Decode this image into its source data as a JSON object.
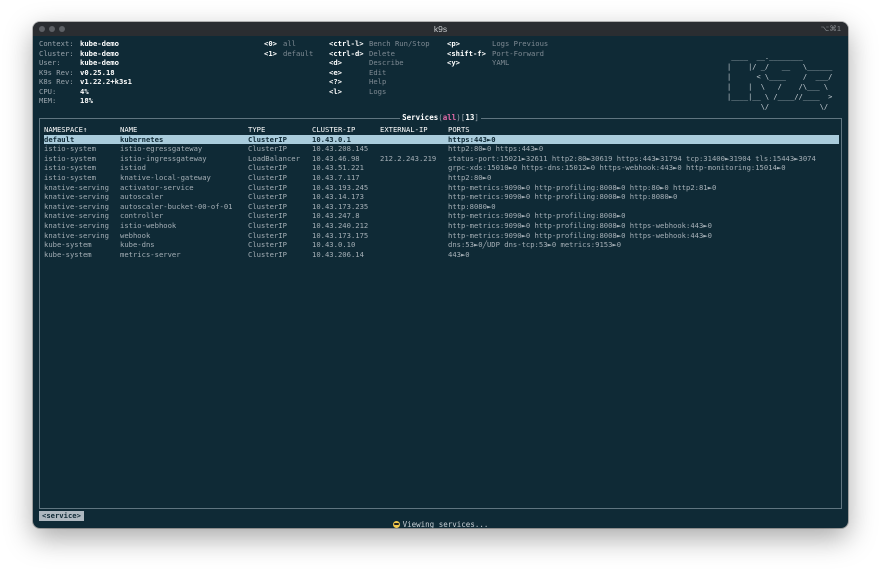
{
  "window": {
    "title": "k9s",
    "shortcut_hint": "⌥⌘1"
  },
  "info": [
    {
      "label": "Context:",
      "value": "kube-demo"
    },
    {
      "label": "Cluster:",
      "value": "kube-demo"
    },
    {
      "label": "User:",
      "value": "kube-demo"
    },
    {
      "label": "K9s Rev:",
      "value": "v0.25.18"
    },
    {
      "label": "K8s Rev:",
      "value": "v1.22.2+k3s1"
    },
    {
      "label": "CPU:",
      "value": "4%"
    },
    {
      "label": "MEM:",
      "value": "18%"
    }
  ],
  "namespace_shortcuts": [
    {
      "key": "<0>",
      "desc": "all"
    },
    {
      "key": "<1>",
      "desc": "default"
    }
  ],
  "hotkeys_col1": [
    {
      "key": "<ctrl-l>",
      "desc": "Bench Run/Stop"
    },
    {
      "key": "<ctrl-d>",
      "desc": "Delete"
    },
    {
      "key": "<d>",
      "desc": "Describe"
    },
    {
      "key": "<e>",
      "desc": "Edit"
    },
    {
      "key": "<?>",
      "desc": "Help"
    },
    {
      "key": "<l>",
      "desc": "Logs"
    }
  ],
  "hotkeys_col2": [
    {
      "key": "<p>",
      "desc": "Logs Previous"
    },
    {
      "key": "<shift-f>",
      "desc": "Port-Forward"
    },
    {
      "key": "<y>",
      "desc": "YAML"
    }
  ],
  "logo": [
    " ____  __.________        ",
    "|    |/ _/   __   \\______ ",
    "|      < \\____    /  ___/ ",
    "|    |  \\   /    /\\___ \\  ",
    "|____|__ \\ /____//____  > ",
    "        \\/            \\/  "
  ],
  "table": {
    "title_name": "Services",
    "title_scope": "all",
    "title_count": "13",
    "headers": [
      "NAMESPACE↑",
      "NAME",
      "TYPE",
      "CLUSTER-IP",
      "EXTERNAL-IP",
      "PORTS"
    ],
    "rows": [
      [
        "default",
        "kubernetes",
        "ClusterIP",
        "10.43.0.1",
        "",
        "https:443►0"
      ],
      [
        "istio-system",
        "istio-egressgateway",
        "ClusterIP",
        "10.43.208.145",
        "",
        "http2:80►0 https:443►0"
      ],
      [
        "istio-system",
        "istio-ingressgateway",
        "LoadBalancer",
        "10.43.46.98",
        "212.2.243.219",
        "status-port:15021►32611 http2:80►30619 https:443►31794 tcp:31400►31904 tls:15443►3074"
      ],
      [
        "istio-system",
        "istiod",
        "ClusterIP",
        "10.43.51.221",
        "",
        "grpc-xds:15010►0 https-dns:15012►0 https-webhook:443►0 http-monitoring:15014►0"
      ],
      [
        "istio-system",
        "knative-local-gateway",
        "ClusterIP",
        "10.43.7.117",
        "",
        "http2:80►0"
      ],
      [
        "knative-serving",
        "activator-service",
        "ClusterIP",
        "10.43.193.245",
        "",
        "http-metrics:9090►0 http-profiling:8008►0 http:80►0 http2:81►0"
      ],
      [
        "knative-serving",
        "autoscaler",
        "ClusterIP",
        "10.43.14.173",
        "",
        "http-metrics:9090►0 http-profiling:8008►0 http:8080►0"
      ],
      [
        "knative-serving",
        "autoscaler-bucket-00-of-01",
        "ClusterIP",
        "10.43.173.235",
        "",
        "http:8080►0"
      ],
      [
        "knative-serving",
        "controller",
        "ClusterIP",
        "10.43.247.8",
        "",
        "http-metrics:9090►0 http-profiling:8008►0"
      ],
      [
        "knative-serving",
        "istio-webhook",
        "ClusterIP",
        "10.43.240.212",
        "",
        "http-metrics:9090►0 http-profiling:8008►0 https-webhook:443►0"
      ],
      [
        "knative-serving",
        "webhook",
        "ClusterIP",
        "10.43.173.175",
        "",
        "http-metrics:9090►0 http-profiling:8008►0 https-webhook:443►0"
      ],
      [
        "kube-system",
        "kube-dns",
        "ClusterIP",
        "10.43.0.10",
        "",
        "dns:53►0╱UDP dns-tcp:53►0 metrics:9153►0"
      ],
      [
        "kube-system",
        "metrics-server",
        "ClusterIP",
        "10.43.206.14",
        "",
        "443►0"
      ]
    ]
  },
  "breadcrumb": "<service>",
  "status": "Viewing services...",
  "colors": {
    "background": "#0f2a36",
    "selected_row": "#a9ccdc",
    "scope_accent": "#e36aa8"
  }
}
